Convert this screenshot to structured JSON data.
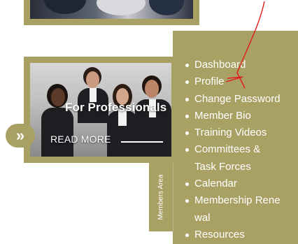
{
  "colors": {
    "brand_olive": "#a9a064",
    "text_white": "#ffffff",
    "annotation_red": "#e01b1b"
  },
  "card": {
    "title": "For Professionals",
    "read_more": "READ MORE",
    "arrow_icon": "double-chevron-right-icon"
  },
  "menu": {
    "items": [
      {
        "label": "Dashboard"
      },
      {
        "label": "Profile"
      },
      {
        "label": "Change Password"
      },
      {
        "label": "Member Bio"
      },
      {
        "label": "Training Videos"
      },
      {
        "label": "Committees &\nTask Forces"
      },
      {
        "label": "Calendar"
      },
      {
        "label": "Membership Rene\nwal"
      },
      {
        "label": "Resources"
      }
    ]
  },
  "members_tab": {
    "label": "Members Area"
  }
}
